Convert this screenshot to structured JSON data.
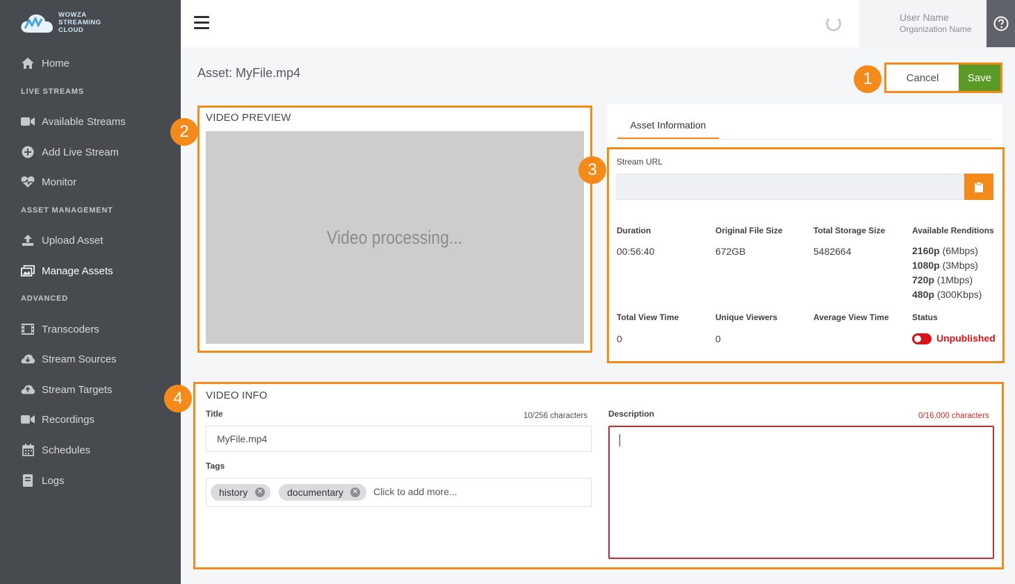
{
  "logo": {
    "line1": "WOWZA",
    "line2": "STREAMING",
    "line3": "CLOUD"
  },
  "sidebar": {
    "home": "Home",
    "section_live": "LIVE STREAMS",
    "available_streams": "Available Streams",
    "add_live_stream": "Add Live Stream",
    "monitor": "Monitor",
    "section_assets": "ASSET MANAGEMENT",
    "upload_asset": "Upload Asset",
    "manage_assets": "Manage Assets",
    "section_advanced": "ADVANCED",
    "transcoders": "Transcoders",
    "stream_sources": "Stream Sources",
    "stream_targets": "Stream Targets",
    "recordings": "Recordings",
    "schedules": "Schedules",
    "logs": "Logs"
  },
  "topbar": {
    "user_name": "User Name",
    "org_name": "Organization Name"
  },
  "page": {
    "title": "Asset: MyFile.mp4"
  },
  "actions": {
    "cancel": "Cancel",
    "save": "Save"
  },
  "badges": {
    "b1": "1",
    "b2": "2",
    "b3": "3",
    "b4": "4"
  },
  "preview": {
    "label": "VIDEO PREVIEW",
    "status": "Video processing..."
  },
  "asset_info": {
    "tab": "Asset Information",
    "stream_url_label": "Stream URL",
    "stream_url_value": "",
    "duration_label": "Duration",
    "duration_value": "00:56:40",
    "file_size_label": "Original File Size",
    "file_size_value": "672GB",
    "storage_label": "Total Storage Size",
    "storage_value": "5482664",
    "renditions_label": "Available Renditions",
    "renditions": [
      {
        "res": "2160p",
        "rate": "(6Mbps)"
      },
      {
        "res": "1080p",
        "rate": "(3Mbps)"
      },
      {
        "res": "720p",
        "rate": "(1Mbps)"
      },
      {
        "res": "480p",
        "rate": "(300Kbps)"
      }
    ],
    "view_time_label": "Total View Time",
    "view_time_value": "0",
    "unique_viewers_label": "Unique Viewers",
    "unique_viewers_value": "0",
    "avg_view_label": "Average View Time",
    "status_label": "Status",
    "status_value": "Unpublished"
  },
  "video_info": {
    "label": "VIDEO INFO",
    "title_label": "Title",
    "title_counter": "10/256 characters",
    "title_value": "MyFile.mp4",
    "tags_label": "Tags",
    "tags": [
      "history",
      "documentary"
    ],
    "tags_placeholder": "Click to add more...",
    "description_label": "Description",
    "description_counter": "0/16,000 characters",
    "description_value": ""
  },
  "colors": {
    "accent": "#f48a1a",
    "save": "#5b9a27",
    "error": "#d7141a",
    "sidebar": "#474a4f"
  }
}
